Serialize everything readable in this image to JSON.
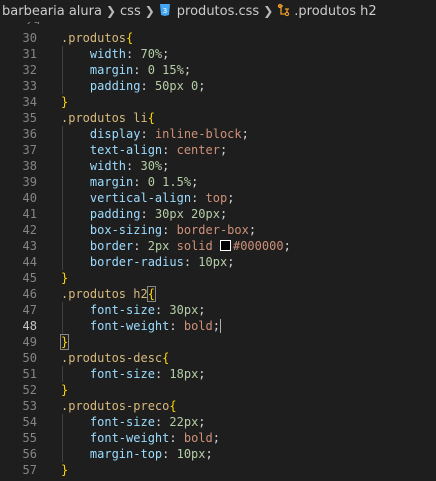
{
  "breadcrumb": {
    "folder": "barbearia alura",
    "subfolder": "css",
    "file": "produtos.css",
    "symbol": ".produtos h2",
    "file_icon": "css-file-icon",
    "symbol_icon": "symbol-class-icon"
  },
  "gutter_top": "29",
  "colors": {
    "selector": "#d7ba7d",
    "property": "#9cdcfe",
    "value": "#ce9178",
    "number": "#b5cea8",
    "brace": "#ffd700",
    "background": "#1e1e1e",
    "line_number": "#858585"
  },
  "editor": {
    "active_line": "48",
    "lines": [
      {
        "n": "30",
        "parts": [
          [
            "sel",
            ".produtos"
          ],
          [
            "brace",
            "{"
          ]
        ]
      },
      {
        "n": "31",
        "parts": [
          [
            "ws",
            "    "
          ],
          [
            "prop",
            "width"
          ],
          [
            "punc",
            ": "
          ],
          [
            "num",
            "70%"
          ],
          [
            "punc",
            ";"
          ]
        ]
      },
      {
        "n": "32",
        "parts": [
          [
            "ws",
            "    "
          ],
          [
            "prop",
            "margin"
          ],
          [
            "punc",
            ": "
          ],
          [
            "num",
            "0 15%"
          ],
          [
            "punc",
            ";"
          ]
        ]
      },
      {
        "n": "33",
        "parts": [
          [
            "ws",
            "    "
          ],
          [
            "prop",
            "padding"
          ],
          [
            "punc",
            ": "
          ],
          [
            "num",
            "50px 0"
          ],
          [
            "punc",
            ";"
          ]
        ]
      },
      {
        "n": "34",
        "parts": [
          [
            "brace",
            "}"
          ]
        ]
      },
      {
        "n": "35",
        "parts": [
          [
            "sel",
            ".produtos li"
          ],
          [
            "brace",
            "{"
          ]
        ]
      },
      {
        "n": "36",
        "parts": [
          [
            "ws",
            "    "
          ],
          [
            "prop",
            "display"
          ],
          [
            "punc",
            ": "
          ],
          [
            "val",
            "inline-block"
          ],
          [
            "punc",
            ";"
          ]
        ]
      },
      {
        "n": "37",
        "parts": [
          [
            "ws",
            "    "
          ],
          [
            "prop",
            "text-align"
          ],
          [
            "punc",
            ": "
          ],
          [
            "val",
            "center"
          ],
          [
            "punc",
            ";"
          ]
        ]
      },
      {
        "n": "38",
        "parts": [
          [
            "ws",
            "    "
          ],
          [
            "prop",
            "width"
          ],
          [
            "punc",
            ": "
          ],
          [
            "num",
            "30%"
          ],
          [
            "punc",
            ";"
          ]
        ]
      },
      {
        "n": "39",
        "parts": [
          [
            "ws",
            "    "
          ],
          [
            "prop",
            "margin"
          ],
          [
            "punc",
            ": "
          ],
          [
            "num",
            "0 1.5%"
          ],
          [
            "punc",
            ";"
          ]
        ]
      },
      {
        "n": "40",
        "parts": [
          [
            "ws",
            "    "
          ],
          [
            "prop",
            "vertical-align"
          ],
          [
            "punc",
            ": "
          ],
          [
            "val",
            "top"
          ],
          [
            "punc",
            ";"
          ]
        ]
      },
      {
        "n": "41",
        "parts": [
          [
            "ws",
            "    "
          ],
          [
            "prop",
            "padding"
          ],
          [
            "punc",
            ": "
          ],
          [
            "num",
            "30px 20px"
          ],
          [
            "punc",
            ";"
          ]
        ]
      },
      {
        "n": "42",
        "parts": [
          [
            "ws",
            "    "
          ],
          [
            "prop",
            "box-sizing"
          ],
          [
            "punc",
            ": "
          ],
          [
            "val",
            "border-box"
          ],
          [
            "punc",
            ";"
          ]
        ]
      },
      {
        "n": "43",
        "parts": [
          [
            "ws",
            "    "
          ],
          [
            "prop",
            "border"
          ],
          [
            "punc",
            ": "
          ],
          [
            "num",
            "2px"
          ],
          [
            "val",
            " solid "
          ],
          [
            "swatch",
            ""
          ],
          [
            "val",
            "#000000"
          ],
          [
            "punc",
            ";"
          ]
        ]
      },
      {
        "n": "44",
        "parts": [
          [
            "ws",
            "    "
          ],
          [
            "prop",
            "border-radius"
          ],
          [
            "punc",
            ": "
          ],
          [
            "num",
            "10px"
          ],
          [
            "punc",
            ";"
          ]
        ]
      },
      {
        "n": "45",
        "parts": [
          [
            "brace",
            "}"
          ]
        ]
      },
      {
        "n": "46",
        "parts": [
          [
            "sel",
            ".produtos h2"
          ],
          [
            "brace-match",
            "{"
          ]
        ]
      },
      {
        "n": "47",
        "parts": [
          [
            "ws",
            "    "
          ],
          [
            "prop",
            "font-size"
          ],
          [
            "punc",
            ": "
          ],
          [
            "num",
            "30px"
          ],
          [
            "punc",
            ";"
          ]
        ]
      },
      {
        "n": "48",
        "parts": [
          [
            "ws",
            "    "
          ],
          [
            "prop",
            "font-weight"
          ],
          [
            "punc",
            ": "
          ],
          [
            "val",
            "bold"
          ],
          [
            "punc",
            ";"
          ],
          [
            "cursor",
            ""
          ]
        ]
      },
      {
        "n": "49",
        "parts": [
          [
            "brace-match",
            "}"
          ]
        ]
      },
      {
        "n": "50",
        "parts": [
          [
            "sel",
            ".produtos-desc"
          ],
          [
            "brace",
            "{"
          ]
        ]
      },
      {
        "n": "51",
        "parts": [
          [
            "ws",
            "    "
          ],
          [
            "prop",
            "font-size"
          ],
          [
            "punc",
            ": "
          ],
          [
            "num",
            "18px"
          ],
          [
            "punc",
            ";"
          ]
        ]
      },
      {
        "n": "52",
        "parts": [
          [
            "brace",
            "}"
          ]
        ]
      },
      {
        "n": "53",
        "parts": [
          [
            "sel",
            ".produtos-preco"
          ],
          [
            "brace",
            "{"
          ]
        ]
      },
      {
        "n": "54",
        "parts": [
          [
            "ws",
            "    "
          ],
          [
            "prop",
            "font-size"
          ],
          [
            "punc",
            ": "
          ],
          [
            "num",
            "22px"
          ],
          [
            "punc",
            ";"
          ]
        ]
      },
      {
        "n": "55",
        "parts": [
          [
            "ws",
            "    "
          ],
          [
            "prop",
            "font-weight"
          ],
          [
            "punc",
            ": "
          ],
          [
            "val",
            "bold"
          ],
          [
            "punc",
            ";"
          ]
        ]
      },
      {
        "n": "56",
        "parts": [
          [
            "ws",
            "    "
          ],
          [
            "prop",
            "margin-top"
          ],
          [
            "punc",
            ": "
          ],
          [
            "num",
            "10px"
          ],
          [
            "punc",
            ";"
          ]
        ]
      },
      {
        "n": "57",
        "parts": [
          [
            "brace",
            "}"
          ]
        ]
      }
    ]
  }
}
